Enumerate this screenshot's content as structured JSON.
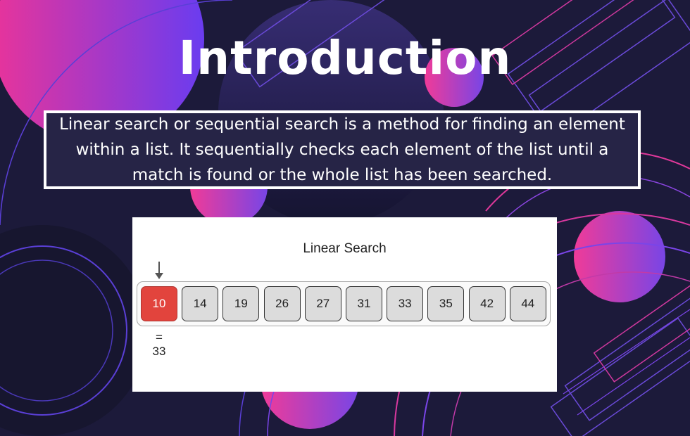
{
  "slide": {
    "title": "Introduction",
    "description": "Linear search or sequential search is a method for finding an element within a list. It sequentially checks each element of the list until a match is found or the whole list has been searched."
  },
  "diagram": {
    "title": "Linear Search",
    "array": [
      "10",
      "14",
      "19",
      "26",
      "27",
      "31",
      "33",
      "35",
      "42",
      "44"
    ],
    "active_index": 0,
    "comparison_symbol": "=",
    "search_value": "33"
  },
  "colors": {
    "background": "#1c1a3a",
    "accent_pink": "#e83e9c",
    "accent_purple": "#7b3fe4",
    "active_cell": "#e2443d",
    "cell": "#dcdcdc"
  }
}
